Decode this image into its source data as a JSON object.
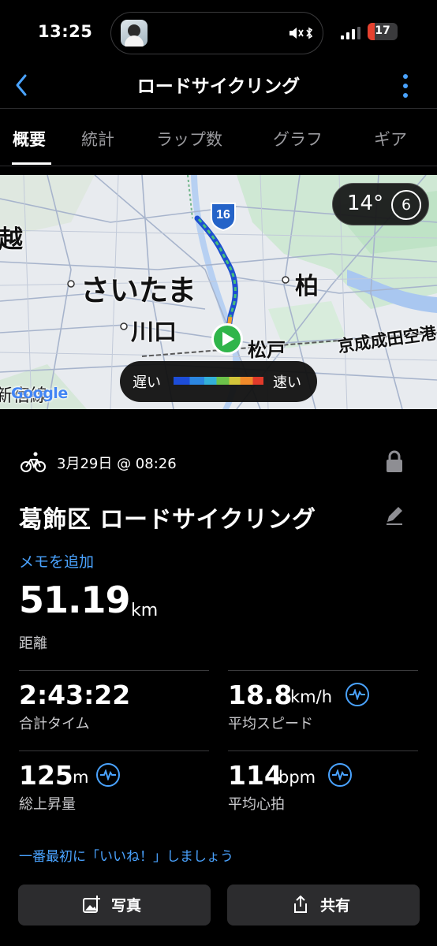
{
  "status_bar": {
    "time": "13:25",
    "battery": "17"
  },
  "header": {
    "title": "ロードサイクリング"
  },
  "tabs": [
    {
      "label": "概要",
      "active": true
    },
    {
      "label": "統計"
    },
    {
      "label": "ラップ数"
    },
    {
      "label": "グラフ"
    },
    {
      "label": "ギア"
    }
  ],
  "map": {
    "places": [
      "越",
      "さいたま",
      "川口",
      "柏",
      "松戸",
      "京成成田空港",
      "新宿線"
    ],
    "route_shield": "16",
    "weather": {
      "temp": "14°",
      "uv": "6"
    },
    "legend": {
      "slow": "遅い",
      "fast": "速い"
    },
    "attribution": "Google"
  },
  "activity": {
    "date": "3月29日 @ 08:26",
    "title": "葛飾区 ロードサイクリング",
    "memo_link": "メモを追加",
    "distance": {
      "value": "51.19",
      "unit": "km",
      "label": "距離"
    },
    "stats": {
      "total_time": {
        "value": "2:43:22",
        "unit": "",
        "label": "合計タイム"
      },
      "avg_speed": {
        "value": "18.8",
        "unit": "km/h",
        "label": "平均スピード"
      },
      "elevation": {
        "value": "125",
        "unit": "m",
        "label": "総上昇量"
      },
      "avg_hr": {
        "value": "114",
        "unit": "bpm",
        "label": "平均心拍"
      }
    },
    "kudos_prompt": "一番最初に「いいね！」しましょう",
    "buttons": {
      "photo": "写真",
      "share": "共有"
    }
  },
  "colors": {
    "accent": "#4aa3ff",
    "background": "#000000",
    "button": "#2c2c2e",
    "start_marker": "#2fb54a"
  }
}
